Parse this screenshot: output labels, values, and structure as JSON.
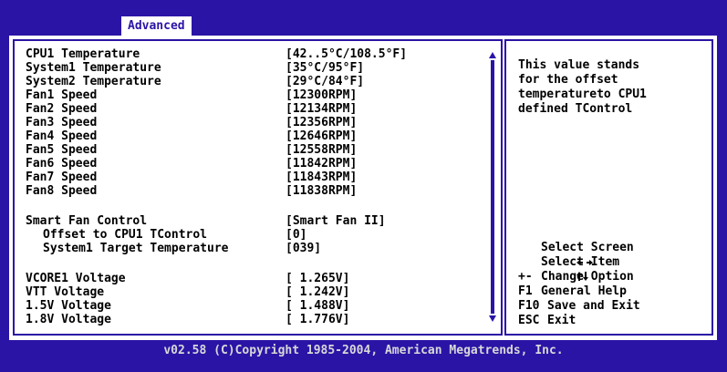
{
  "header": {
    "tab_label": "Advanced"
  },
  "settings": [
    {
      "label": "CPU1 Temperature",
      "value": "[42..5°C/108.5°F]"
    },
    {
      "label": "System1 Temperature",
      "value": "[35°C/95°F]"
    },
    {
      "label": "System2 Temperature",
      "value": "[29°C/84°F]"
    },
    {
      "label": "Fan1 Speed",
      "value": "[12300RPM]"
    },
    {
      "label": "Fan2 Speed",
      "value": "[12134RPM]"
    },
    {
      "label": "Fan3 Speed",
      "value": "[12356RPM]"
    },
    {
      "label": "Fan4 Speed",
      "value": "[12646RPM]"
    },
    {
      "label": "Fan5 Speed",
      "value": "[12558RPM]"
    },
    {
      "label": "Fan6 Speed",
      "value": "[11842RPM]"
    },
    {
      "label": "Fan7 Speed",
      "value": "[11843RPM]"
    },
    {
      "label": "Fan8 Speed",
      "value": "[11838RPM]"
    },
    {
      "label": "Smart Fan Control",
      "value": "[Smart Fan II]"
    },
    {
      "label": "Offset to CPU1 TControl",
      "value": "[0]"
    },
    {
      "label": "System1 Target Temperature",
      "value": "[039]"
    },
    {
      "label": "VCORE1 Voltage",
      "value": "[ 1.265V]"
    },
    {
      "label": "VTT Voltage",
      "value": "[ 1.242V]"
    },
    {
      "label": "1.5V Voltage",
      "value": "[ 1.488V]"
    },
    {
      "label": "1.8V Voltage",
      "value": "[ 1.776V]"
    }
  ],
  "help": {
    "lines": [
      "This value stands",
      "for the offset",
      "temperatureto CPU1",
      "defined TControl"
    ]
  },
  "keys": [
    {
      "key_icon": "left-right-arrows-icon",
      "desc": "Select Screen"
    },
    {
      "key_icon": "up-down-arrows-icon",
      "desc": "Select Item"
    },
    {
      "key": "+-",
      "desc": "Change Option"
    },
    {
      "key": "F1",
      "desc": "General Help"
    },
    {
      "key": "F10",
      "desc": "Save and Exit"
    },
    {
      "key": "ESC",
      "desc": "Exit"
    }
  ],
  "footer": {
    "copyright": "v02.58 (C)Copyright 1985-2004, American Megatrends, Inc."
  },
  "colors": {
    "background": "#2a14a6",
    "panel": "#ffffff",
    "text": "#000000",
    "footer_text": "#d8d8d8"
  }
}
